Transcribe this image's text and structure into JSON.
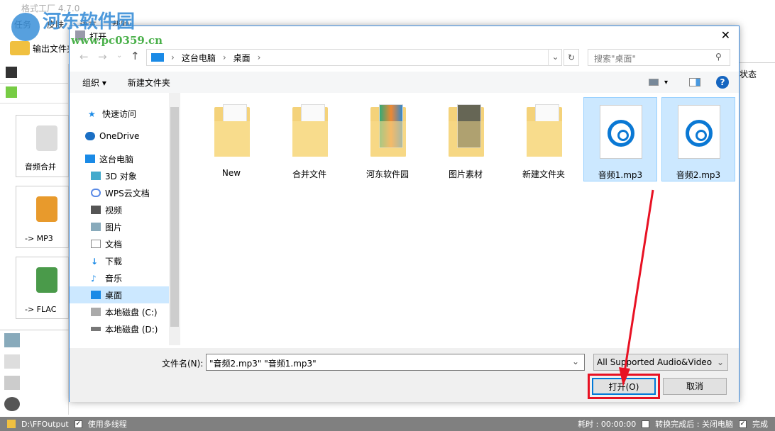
{
  "app": {
    "title": "格式工厂 4.7.0",
    "menu": [
      "任务",
      "皮肤",
      "语言",
      "帮助"
    ],
    "output_folder": "输出文件夹",
    "column_status": "状态",
    "tools": [
      "音频合并",
      "-> MP3",
      "-> FLAC"
    ],
    "watermark": "河东软件园",
    "watermark_url": "www.pc0359.cn"
  },
  "status_bar": {
    "path": "D:\\FFOutput",
    "multithread": "使用多线程",
    "elapsed": "耗时 : 00:00:00",
    "after_convert": "转换完成后 : 关闭电脑",
    "complete": "完成"
  },
  "dialog": {
    "title": "打开",
    "breadcrumb": [
      "这台电脑",
      "桌面"
    ],
    "search_placeholder": "搜索\"桌面\"",
    "toolbar": {
      "organize": "组织",
      "new_folder": "新建文件夹"
    },
    "nav": [
      "快速访问",
      "OneDrive",
      "这台电脑",
      "3D 对象",
      "WPS云文档",
      "视频",
      "图片",
      "文档",
      "下载",
      "音乐",
      "桌面",
      "本地磁盘 (C:)",
      "本地磁盘 (D:)"
    ],
    "files": [
      {
        "name": "New",
        "type": "folder"
      },
      {
        "name": "合并文件",
        "type": "folder"
      },
      {
        "name": "河东软件园",
        "type": "folder"
      },
      {
        "name": "图片素材",
        "type": "folder"
      },
      {
        "name": "新建文件夹",
        "type": "folder"
      },
      {
        "name": "音频1.mp3",
        "type": "audio",
        "selected": true
      },
      {
        "name": "音频2.mp3",
        "type": "audio",
        "selected": true
      }
    ],
    "filename_label": "文件名(N):",
    "filename_value": "\"音频2.mp3\" \"音频1.mp3\"",
    "filter": "All Supported Audio&Video",
    "open": "打开(O)",
    "cancel": "取消"
  },
  "colors": {
    "accent": "#0078d7",
    "highlight": "#e81123",
    "selection": "#cce8ff"
  }
}
